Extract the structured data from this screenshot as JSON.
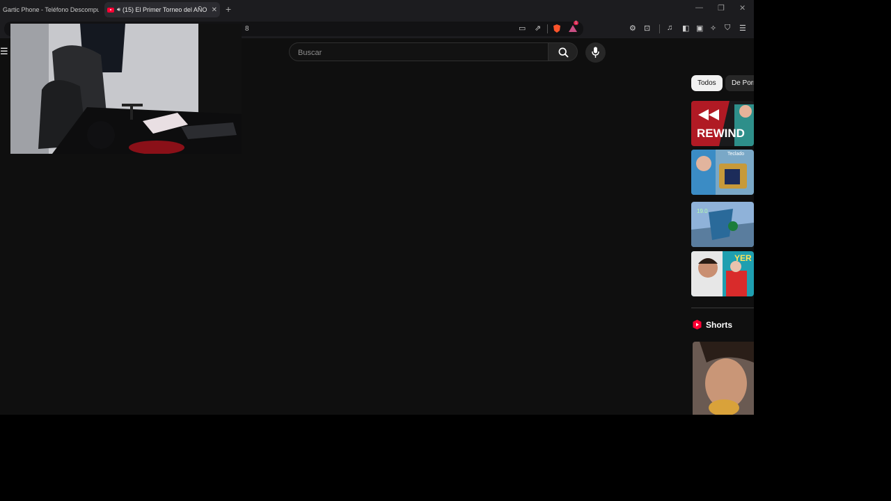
{
  "tabs": [
    {
      "title": "Gartic Phone - Teléfono Descompue",
      "active": false
    },
    {
      "title": "(15) El Primer Torneo del AÑO",
      "active": true
    }
  ],
  "toolbar": {
    "url_fragment": "8",
    "badge_count": "1"
  },
  "search": {
    "placeholder": "Buscar"
  },
  "chips": [
    "Todos",
    "De Porr"
  ],
  "thumbnails": [
    {
      "overlay_text": "REWIND"
    },
    {
      "overlay_text": "Teclado"
    },
    {
      "overlay_text": "19.0"
    },
    {
      "overlay_text": "YER"
    }
  ],
  "shorts": {
    "label": "Shorts"
  },
  "colors": {
    "accent": "#ff0033",
    "background": "#0f0f0f",
    "chrome": "#1c1c1f"
  }
}
